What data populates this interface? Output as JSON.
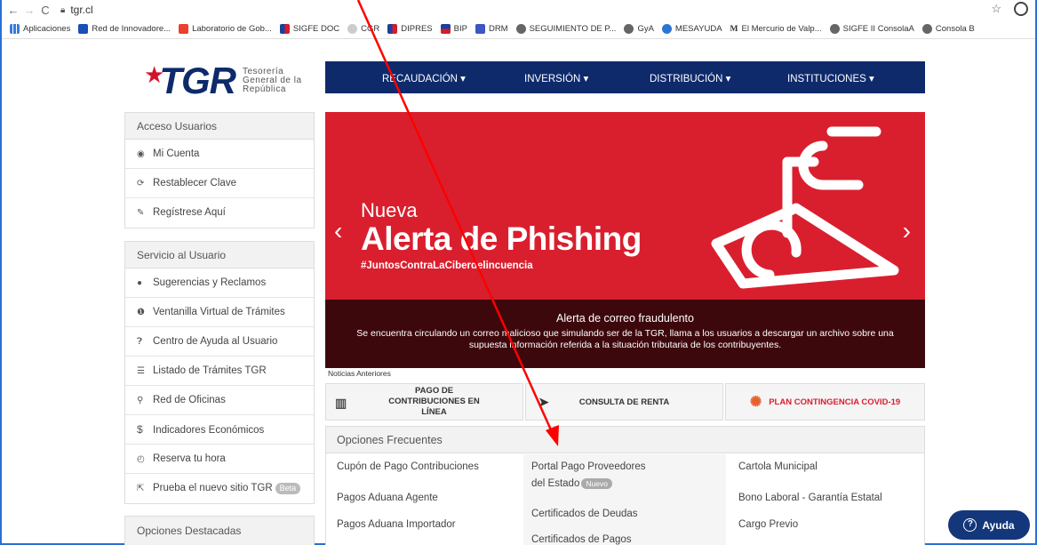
{
  "browser": {
    "url": "tgr.cl",
    "bookmarks": [
      "Aplicaciones",
      "Red de Innovadore...",
      "Laboratorio de Gob...",
      "SIGFE DOC",
      "CGR",
      "DIPRES",
      "BIP",
      "DRM",
      "SEGUIMIENTO DE P...",
      "GyA",
      "MESAYUDA",
      "El Mercurio de Valp...",
      "SIGFE II ConsolaA",
      "Consola B"
    ]
  },
  "logo": {
    "brand": "TGR",
    "line1": "Tesorería",
    "line2": "General de la",
    "line3": "República"
  },
  "topnav": [
    "RECAUDACIÓN ▾",
    "INVERSIÓN ▾",
    "DISTRIBUCIÓN ▾",
    "INSTITUCIONES ▾"
  ],
  "acceso": {
    "title": "Acceso Usuarios",
    "items": [
      "Mi Cuenta",
      "Restablecer Clave",
      "Regístrese Aquí"
    ]
  },
  "servicio": {
    "title": "Servicio al Usuario",
    "items": [
      "Sugerencias y Reclamos",
      "Ventanilla Virtual de Trámites",
      "Centro de Ayuda al Usuario",
      "Listado de Trámites TGR",
      "Red de Oficinas",
      "Indicadores Económicos",
      "Reserva tu hora",
      "Prueba el nuevo sitio TGR"
    ],
    "beta": "Beta"
  },
  "destacadas": {
    "title": "Opciones Destacadas"
  },
  "hero": {
    "nueva": "Nueva",
    "headline": "Alerta de Phishing",
    "hashtag": "#JuntosContraLaCiberdelincuencia",
    "caption_title": "Alerta de correo fraudulento",
    "caption_text": "Se encuentra circulando un correo malicioso que simulando ser de la TGR, llama a los usuarios a descargar un archivo sobre una supuesta información referida a la situación tributaria de los contribuyentes."
  },
  "noticias": "Noticias Anteriores",
  "quick": {
    "pago": "PAGO DE CONTRIBUCIONES EN LÍNEA",
    "renta": "CONSULTA DE RENTA",
    "covid": "PLAN CONTINGENCIA COVID-19"
  },
  "frecuentes": {
    "title": "Opciones Frecuentes",
    "col1": [
      "Cupón de Pago Contribuciones",
      "Pagos Aduana Agente",
      "Pagos Aduana Importador"
    ],
    "col2": [
      "Portal Pago Proveedores",
      "del Estado",
      "Certificados de Deudas",
      "Certificados de Pagos"
    ],
    "nuevo": "Nuevo",
    "col3": [
      "Cartola Municipal",
      "Bono Laboral - Garantía Estatal",
      "Cargo Previo"
    ]
  },
  "ayuda": "Ayuda",
  "colors": {
    "navy": "#0e2a6b",
    "red": "#d91f2e",
    "annotation": "#ff0000"
  }
}
